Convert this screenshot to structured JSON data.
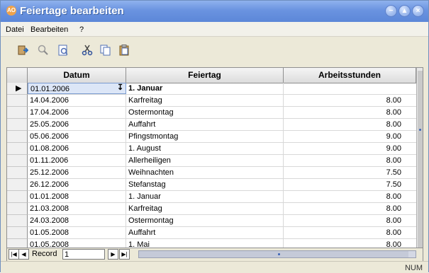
{
  "window": {
    "title": "Feiertage bearbeiten",
    "icon_text": "AO"
  },
  "menu": [
    {
      "label": "Datei"
    },
    {
      "label": "Bearbeiten"
    },
    {
      "label": "?"
    }
  ],
  "toolbar": {
    "icons": [
      "exit-icon",
      "find-icon",
      "preview-icon",
      "cut-icon",
      "copy-icon",
      "paste-icon"
    ]
  },
  "grid": {
    "columns": [
      "Datum",
      "Feiertag",
      "Arbeitsstunden"
    ],
    "rows": [
      {
        "date": "01.01.2006",
        "name": "1. Januar",
        "hours": ""
      },
      {
        "date": "14.04.2006",
        "name": "Karfreitag",
        "hours": "8.00"
      },
      {
        "date": "17.04.2006",
        "name": "Ostermontag",
        "hours": "8.00"
      },
      {
        "date": "25.05.2006",
        "name": "Auffahrt",
        "hours": "8.00"
      },
      {
        "date": "05.06.2006",
        "name": "Pfingstmontag",
        "hours": "9.00"
      },
      {
        "date": "01.08.2006",
        "name": "1. August",
        "hours": "9.00"
      },
      {
        "date": "01.11.2006",
        "name": "Allerheiligen",
        "hours": "8.00"
      },
      {
        "date": "25.12.2006",
        "name": "Weihnachten",
        "hours": "7.50"
      },
      {
        "date": "26.12.2006",
        "name": "Stefanstag",
        "hours": "7.50"
      },
      {
        "date": "01.01.2008",
        "name": "1. Januar",
        "hours": "8.00"
      },
      {
        "date": "21.03.2008",
        "name": "Karfreitag",
        "hours": "8.00"
      },
      {
        "date": "24.03.2008",
        "name": "Ostermontag",
        "hours": "8.00"
      },
      {
        "date": "01.05.2008",
        "name": "Auffahrt",
        "hours": "8.00"
      },
      {
        "date": "01.05.2008",
        "name": "1. Mai",
        "hours": "8.00"
      }
    ]
  },
  "navigation": {
    "record_label": "Record",
    "record_value": "1"
  },
  "status": {
    "num": "NUM"
  }
}
